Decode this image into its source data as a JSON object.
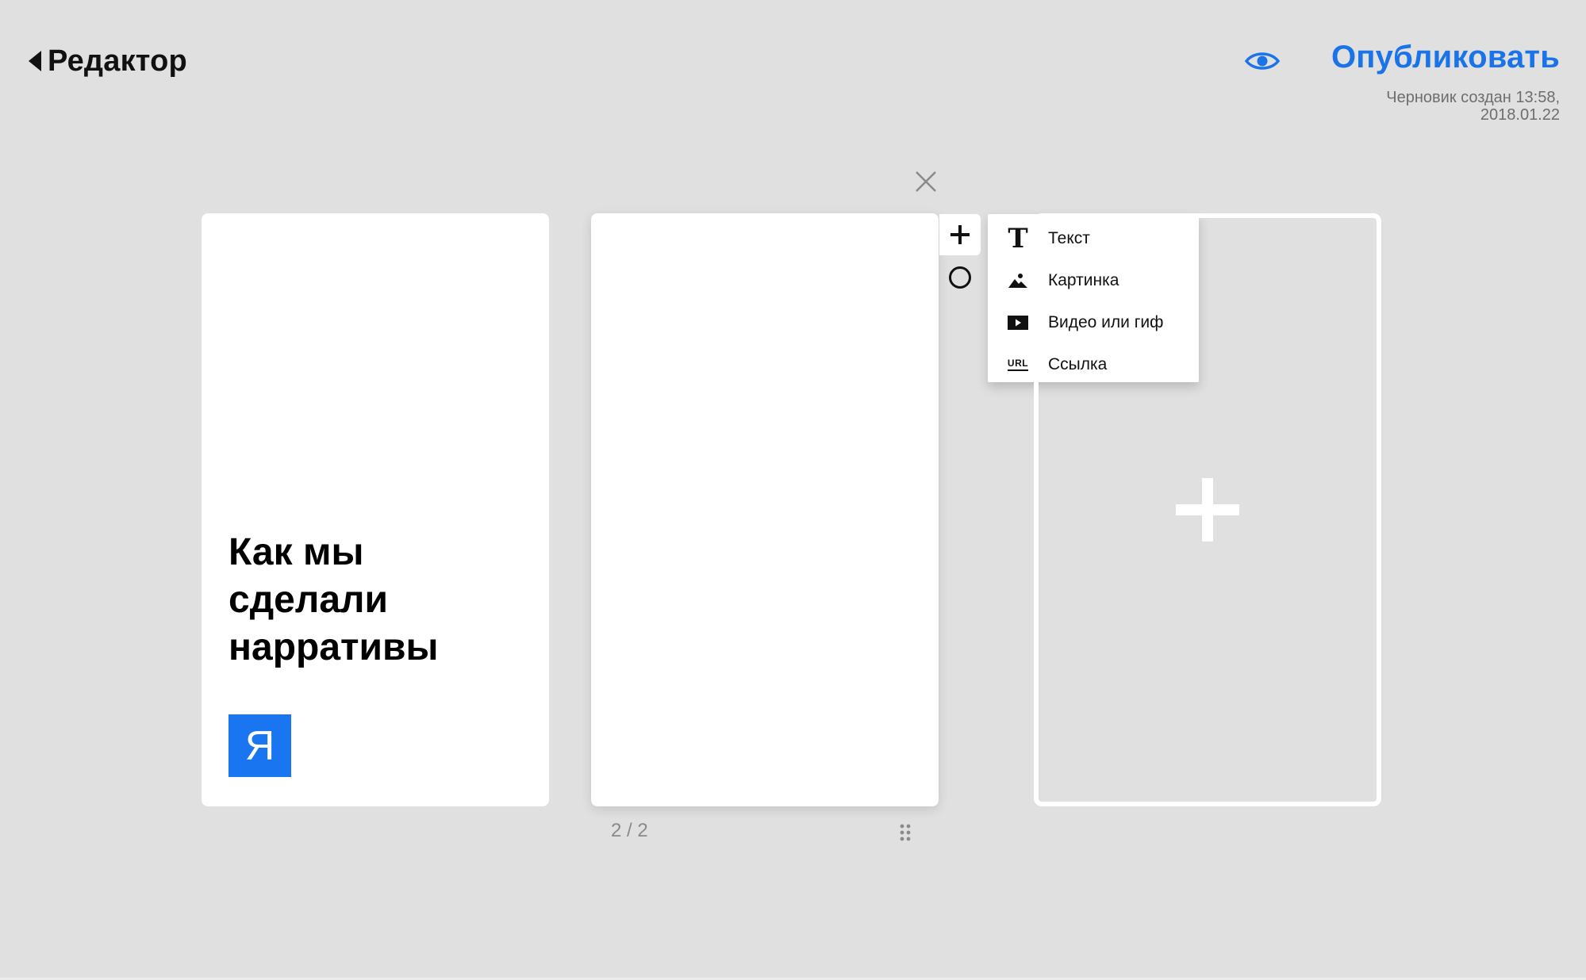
{
  "header": {
    "back_label": "Редактор",
    "publish_label": "Опубликовать",
    "draft_status": "Черновик создан 13:58, 2018.01.22",
    "accent_color": "#1a73e8"
  },
  "slides": {
    "first": {
      "title": "Как мы сделали нарративы",
      "logo_letter": "Я",
      "logo_color": "#1a76f0"
    },
    "page_counter": "2 / 2"
  },
  "add_menu": {
    "items": [
      {
        "icon": "text-icon",
        "label": "Текст"
      },
      {
        "icon": "image-icon",
        "label": "Картинка"
      },
      {
        "icon": "video-icon",
        "label": "Видео или гиф"
      },
      {
        "icon": "url-icon",
        "label": "Ссылка"
      }
    ]
  },
  "icons": {
    "back": "chevron-left-icon",
    "preview": "eye-icon",
    "close": "close-icon",
    "add": "plus-icon",
    "shape": "circle-icon",
    "drag": "drag-handle-icon"
  }
}
